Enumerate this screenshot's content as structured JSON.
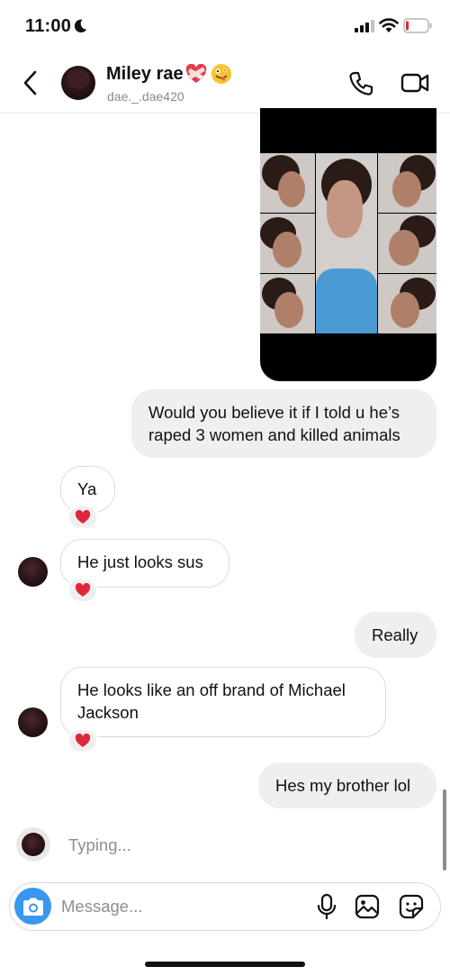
{
  "status_bar": {
    "time": "11:00"
  },
  "header": {
    "contact_name": "Miley rae",
    "username": "dae._.dae420"
  },
  "messages": [
    {
      "direction": "out",
      "type": "photo"
    },
    {
      "direction": "out",
      "text": "Would you believe it if I told u he’s raped 3 women and killed animals"
    },
    {
      "direction": "in",
      "text": "Ya",
      "reaction": "red-heart"
    },
    {
      "direction": "in",
      "text": "He just looks sus",
      "reaction": "red-heart"
    },
    {
      "direction": "out",
      "text": "Really"
    },
    {
      "direction": "in",
      "text": "He looks like an off brand of Michael Jackson",
      "reaction": "red-heart"
    },
    {
      "direction": "out",
      "text": "Hes my brother lol"
    }
  ],
  "typing_indicator": "Typing...",
  "composer": {
    "placeholder": "Message..."
  },
  "colors": {
    "accent": "#3897f0",
    "reaction_heart": "#e0263b",
    "outgoing_bubble": "#efefef"
  }
}
